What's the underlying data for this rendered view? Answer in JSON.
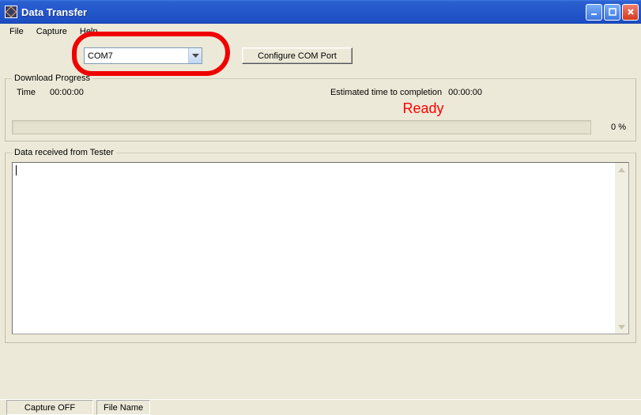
{
  "window": {
    "title": "Data Transfer"
  },
  "menu": {
    "file": "File",
    "capture": "Capture",
    "help": "Help"
  },
  "controls": {
    "com_port": "COM7",
    "configure_label": "Configure COM Port"
  },
  "download": {
    "legend": "Download Progress",
    "time_label": "Time",
    "time_value": "00:00:00",
    "etc_label": "Estimated time to completion",
    "etc_value": "00:00:00",
    "status": "Ready",
    "percent": "0 %"
  },
  "rx": {
    "legend": "Data received from Tester"
  },
  "status": {
    "capture": "Capture OFF",
    "filename_label": "File Name"
  }
}
